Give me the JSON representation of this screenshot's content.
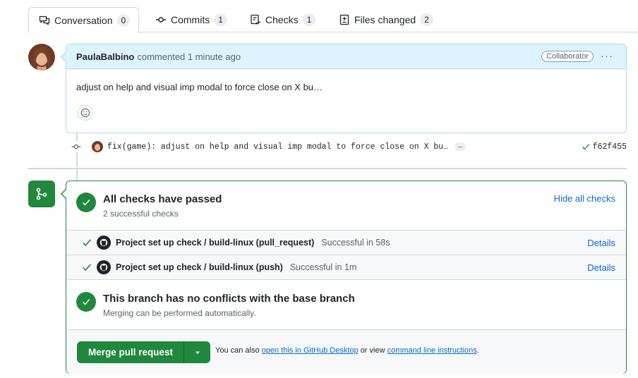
{
  "tabs": [
    {
      "label": "Conversation",
      "count": "0"
    },
    {
      "label": "Commits",
      "count": "1"
    },
    {
      "label": "Checks",
      "count": "1"
    },
    {
      "label": "Files changed",
      "count": "2"
    }
  ],
  "comment": {
    "author": "PaulaBalbino",
    "meta": "commented 1 minute ago",
    "role": "Collaborator",
    "body": "adjust on help and visual imp modal to force close on X bu…"
  },
  "commit": {
    "message": "fix(game): adjust on help and visual imp modal to force close on X bu…",
    "ellipsis": "…",
    "sha": "f62f455"
  },
  "checks": {
    "title": "All checks have passed",
    "subtitle": "2 successful checks",
    "toggle_label": "Hide all checks",
    "items": [
      {
        "name": "Project set up check / build-linux (pull_request)",
        "status": "Successful in 58s",
        "details": "Details"
      },
      {
        "name": "Project set up check / build-linux (push)",
        "status": "Successful in 1m",
        "details": "Details"
      }
    ]
  },
  "conflicts": {
    "title": "This branch has no conflicts with the base branch",
    "subtitle": "Merging can be performed automatically."
  },
  "merge": {
    "button_label": "Merge pull request",
    "also_prefix": "You can also",
    "desktop_link": "open this in GitHub Desktop",
    "or_view": "or view",
    "cli_link": "command line instructions",
    "period": "."
  },
  "colors": {
    "success": "#1f883d",
    "link": "#0969da",
    "header_bg": "#ddf4ff"
  }
}
